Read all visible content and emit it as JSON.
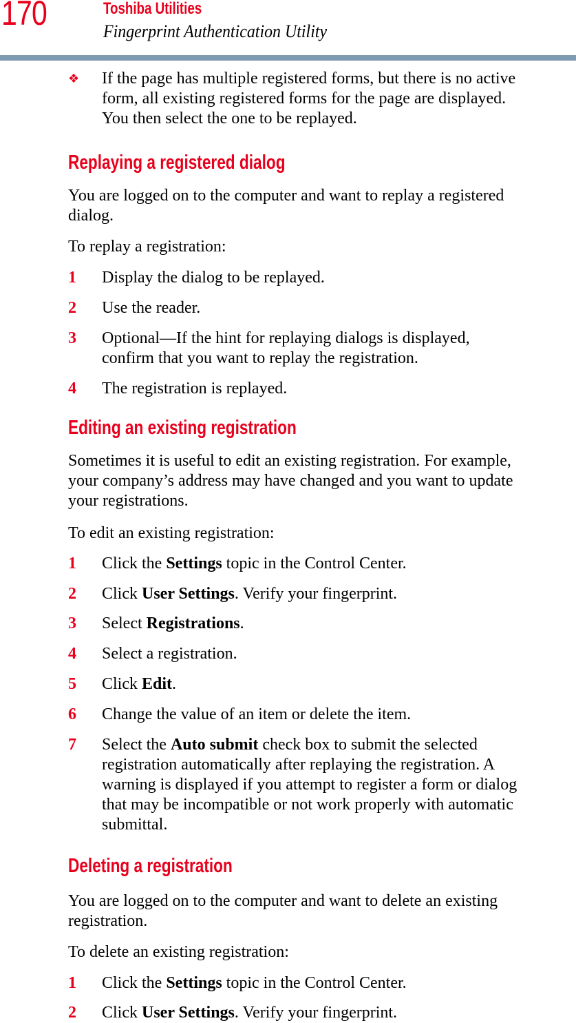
{
  "header": {
    "page_number": "170",
    "section": "Toshiba Utilities",
    "chapter": "Fingerprint Authentication Utility",
    "accent_color": "#e8001c",
    "divider_color": "#7f9ab3"
  },
  "intro_bullet": {
    "icon": "diamond-bullet-icon",
    "lines": [
      "If the page has multiple registered forms, but there is no active",
      "form, all existing registered forms for the page are displayed.",
      "You then select the one to be replayed."
    ]
  },
  "sections": [
    {
      "heading": "Replaying a registered dialog",
      "paragraph_lines": [
        "You are logged on to the computer and want to replay a registered",
        "dialog."
      ],
      "lead_in": "To replay a registration:",
      "steps": [
        {
          "num": "1",
          "pre": "Display the dialog to be replayed.",
          "bold": "",
          "post": ""
        },
        {
          "num": "2",
          "pre": "Use the reader.",
          "bold": "",
          "post": ""
        },
        {
          "num": "3",
          "lines": [
            "Optional—If the hint for replaying dialogs is displayed,",
            "confirm that you want to replay the registration."
          ]
        },
        {
          "num": "4",
          "pre": "The registration is replayed.",
          "bold": "",
          "post": ""
        }
      ]
    },
    {
      "heading": "Editing an existing registration",
      "paragraph_lines": [
        "Sometimes it is useful to edit an existing registration. For example,",
        "your company’s address may have changed and you want to update",
        "your registrations."
      ],
      "lead_in": "To edit an existing registration:",
      "steps": [
        {
          "num": "1",
          "pre": "Click the ",
          "bold": "Settings",
          "post": " topic in the Control Center."
        },
        {
          "num": "2",
          "pre": "Click ",
          "bold": "User Settings",
          "post": ". Verify your fingerprint."
        },
        {
          "num": "3",
          "pre": "Select ",
          "bold": "Registrations",
          "post": "."
        },
        {
          "num": "4",
          "pre": "Select a registration.",
          "bold": "",
          "post": ""
        },
        {
          "num": "5",
          "pre": "Click ",
          "bold": "Edit",
          "post": "."
        },
        {
          "num": "6",
          "pre": "Change the value of an item or delete the item.",
          "bold": "",
          "post": ""
        },
        {
          "num": "7",
          "pre": "Select the ",
          "bold": "Auto submit",
          "post": " check box to submit the selected",
          "more_lines": [
            "registration automatically after replaying the registration. A",
            "warning is displayed if you attempt to register a form or dialog",
            "that may be incompatible or not work properly with automatic",
            "submittal."
          ]
        }
      ]
    },
    {
      "heading": "Deleting a registration",
      "paragraph_lines": [
        "You are logged on to the computer and want to delete an existing",
        "registration."
      ],
      "lead_in": "To delete an existing registration:",
      "steps": [
        {
          "num": "1",
          "pre": "Click the ",
          "bold": "Settings",
          "post": " topic in the Control Center."
        },
        {
          "num": "2",
          "pre": "Click ",
          "bold": "User Settings",
          "post": ". Verify your fingerprint."
        }
      ]
    }
  ]
}
